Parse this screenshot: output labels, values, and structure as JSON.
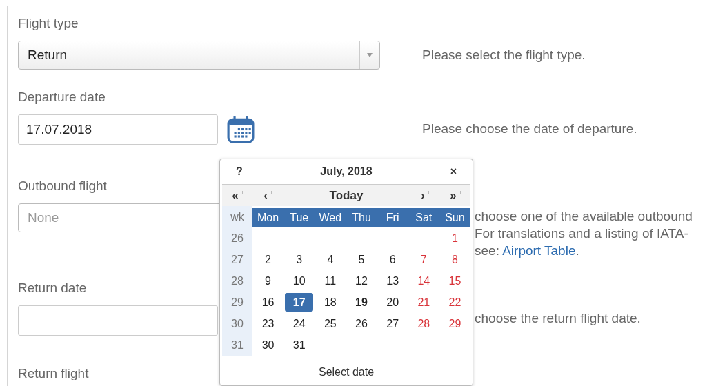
{
  "form": {
    "fields": [
      {
        "kind": "select",
        "label": "Flight type",
        "value": "Return",
        "disabled": false,
        "help": {
          "text": "Please select the flight type.",
          "covered": false
        }
      },
      {
        "kind": "date",
        "label": "Departure date",
        "value": "17.07.2018",
        "focused": true,
        "calendar_button": true,
        "help": {
          "text": "Please choose the date of departure.",
          "covered": false
        }
      },
      {
        "kind": "select",
        "label": "Outbound flight",
        "placeholder": "None",
        "disabled": true,
        "help": {
          "text": "choose one of the available outbound\nFor translations and a listing of IATA-\nsee: ",
          "link": "Airport Table",
          "after": ".",
          "covered": true
        }
      },
      {
        "kind": "date",
        "label": "Return date",
        "focused": false,
        "help": {
          "text": "choose the return flight date.",
          "covered": true
        }
      },
      {
        "kind": "heading",
        "label": "Return flight"
      }
    ]
  },
  "calendar": {
    "help": "?",
    "title": "July, 2018",
    "close": "×",
    "nav": [
      {
        "label": "«"
      },
      {
        "label": "‹"
      },
      {
        "label": "Today"
      },
      {
        "label": "›"
      },
      {
        "label": "»"
      }
    ],
    "week_header": "wk",
    "weekdays": [
      "Mon",
      "Tue",
      "Wed",
      "Thu",
      "Fri",
      "Sat",
      "Sun"
    ],
    "weeks": [
      {
        "number": "26",
        "days": [
          {
            "kind": "blank"
          },
          {
            "kind": "blank"
          },
          {
            "kind": "blank"
          },
          {
            "kind": "blank"
          },
          {
            "kind": "blank"
          },
          {
            "kind": "blank"
          },
          {
            "text": "1",
            "weekend": true,
            "selected": false,
            "today": false
          }
        ]
      },
      {
        "number": "27",
        "days": [
          {
            "text": "2",
            "weekend": false,
            "selected": false,
            "today": false
          },
          {
            "text": "3",
            "weekend": false,
            "selected": false,
            "today": false
          },
          {
            "text": "4",
            "weekend": false,
            "selected": false,
            "today": false
          },
          {
            "text": "5",
            "weekend": false,
            "selected": false,
            "today": false
          },
          {
            "text": "6",
            "weekend": false,
            "selected": false,
            "today": false
          },
          {
            "text": "7",
            "weekend": true,
            "selected": false,
            "today": false
          },
          {
            "text": "8",
            "weekend": true,
            "selected": false,
            "today": false
          }
        ]
      },
      {
        "number": "28",
        "days": [
          {
            "text": "9",
            "weekend": false,
            "selected": false,
            "today": false
          },
          {
            "text": "10",
            "weekend": false,
            "selected": false,
            "today": false
          },
          {
            "text": "11",
            "weekend": false,
            "selected": false,
            "today": false
          },
          {
            "text": "12",
            "weekend": false,
            "selected": false,
            "today": false
          },
          {
            "text": "13",
            "weekend": false,
            "selected": false,
            "today": false
          },
          {
            "text": "14",
            "weekend": true,
            "selected": false,
            "today": false
          },
          {
            "text": "15",
            "weekend": true,
            "selected": false,
            "today": false
          }
        ]
      },
      {
        "number": "29",
        "days": [
          {
            "text": "16",
            "weekend": false,
            "selected": false,
            "today": false
          },
          {
            "text": "17",
            "weekend": false,
            "selected": true,
            "today": false
          },
          {
            "text": "18",
            "weekend": false,
            "selected": false,
            "today": false
          },
          {
            "text": "19",
            "weekend": false,
            "selected": false,
            "today": true
          },
          {
            "text": "20",
            "weekend": false,
            "selected": false,
            "today": false
          },
          {
            "text": "21",
            "weekend": true,
            "selected": false,
            "today": false
          },
          {
            "text": "22",
            "weekend": true,
            "selected": false,
            "today": false
          }
        ]
      },
      {
        "number": "30",
        "days": [
          {
            "text": "23",
            "weekend": false,
            "selected": false,
            "today": false
          },
          {
            "text": "24",
            "weekend": false,
            "selected": false,
            "today": false
          },
          {
            "text": "25",
            "weekend": false,
            "selected": false,
            "today": false
          },
          {
            "text": "26",
            "weekend": false,
            "selected": false,
            "today": false
          },
          {
            "text": "27",
            "weekend": false,
            "selected": false,
            "today": false
          },
          {
            "text": "28",
            "weekend": true,
            "selected": false,
            "today": false
          },
          {
            "text": "29",
            "weekend": true,
            "selected": false,
            "today": false
          }
        ]
      },
      {
        "number": "31",
        "days": [
          {
            "text": "30",
            "weekend": false,
            "selected": false,
            "today": false
          },
          {
            "text": "31",
            "weekend": false,
            "selected": false,
            "today": false
          },
          {
            "kind": "blank"
          },
          {
            "kind": "blank"
          },
          {
            "kind": "blank"
          },
          {
            "kind": "blank"
          },
          {
            "kind": "blank"
          }
        ]
      }
    ],
    "footer": "Select date"
  }
}
